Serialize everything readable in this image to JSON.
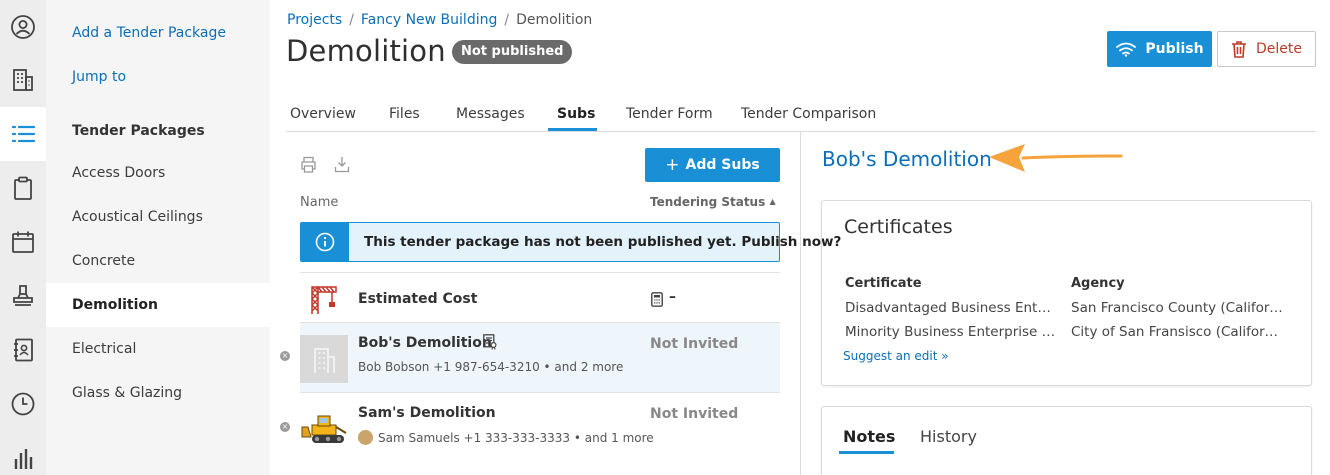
{
  "sidenav": {
    "links": [
      "Add a Tender Package",
      "Jump to"
    ],
    "section_header": "Tender Packages",
    "items": [
      "Access Doors",
      "Acoustical Ceilings",
      "Concrete",
      "Demolition",
      "Electrical",
      "Glass & Glazing"
    ],
    "active_item": "Demolition"
  },
  "rail": {
    "icons": [
      "user-circle-icon",
      "building-icon",
      "list-icon",
      "clipboard-icon",
      "calendar-icon",
      "stamp-icon",
      "contacts-book-icon",
      "clock-icon",
      "bar-chart-icon"
    ],
    "active_icon": "list-icon"
  },
  "breadcrumb": {
    "items": [
      "Projects",
      "Fancy New Building",
      "Demolition"
    ],
    "separator": "/"
  },
  "header": {
    "title": "Demolition",
    "status_badge": "Not published",
    "publish_label": "Publish",
    "delete_label": "Delete"
  },
  "tabs": {
    "items": [
      "Overview",
      "Files",
      "Messages",
      "Subs",
      "Tender Form",
      "Tender Comparison"
    ],
    "active": "Subs"
  },
  "subs_list": {
    "add_button": "Add Subs",
    "columns": {
      "name": "Name",
      "status": "Tendering Status"
    },
    "alert_text": "This tender package has not been published yet. Publish now?",
    "estimated_cost": {
      "label": "Estimated Cost",
      "value": "–"
    },
    "rows": [
      {
        "name": "Bob's Demolition",
        "contact": "Bob Bobson +1 987-654-3210 • and 2 more",
        "status": "Not Invited",
        "selected": true
      },
      {
        "name": "Sam's Demolition",
        "contact": "Sam Samuels +1 333-333-3333 • and 1 more",
        "status": "Not Invited",
        "selected": false
      }
    ]
  },
  "detail": {
    "company_name": "Bob's Demolition",
    "certificates": {
      "title": "Certificates",
      "col_certificate": "Certificate",
      "col_agency": "Agency",
      "rows": [
        {
          "certificate": "Disadvantaged Business Enterprise",
          "agency": "San Francisco County (California)"
        },
        {
          "certificate": "Minority Business Enterprise (MBE)",
          "agency": "City of San Fransisco (California)"
        }
      ],
      "suggest_link": "Suggest an edit »"
    },
    "notes_tabs": [
      "Notes",
      "History"
    ],
    "notes_active": "Notes"
  },
  "colors": {
    "accent": "#1990d6",
    "link": "#0b6fb8",
    "delete": "#c0392b",
    "annotation_arrow": "#f5a33a"
  }
}
